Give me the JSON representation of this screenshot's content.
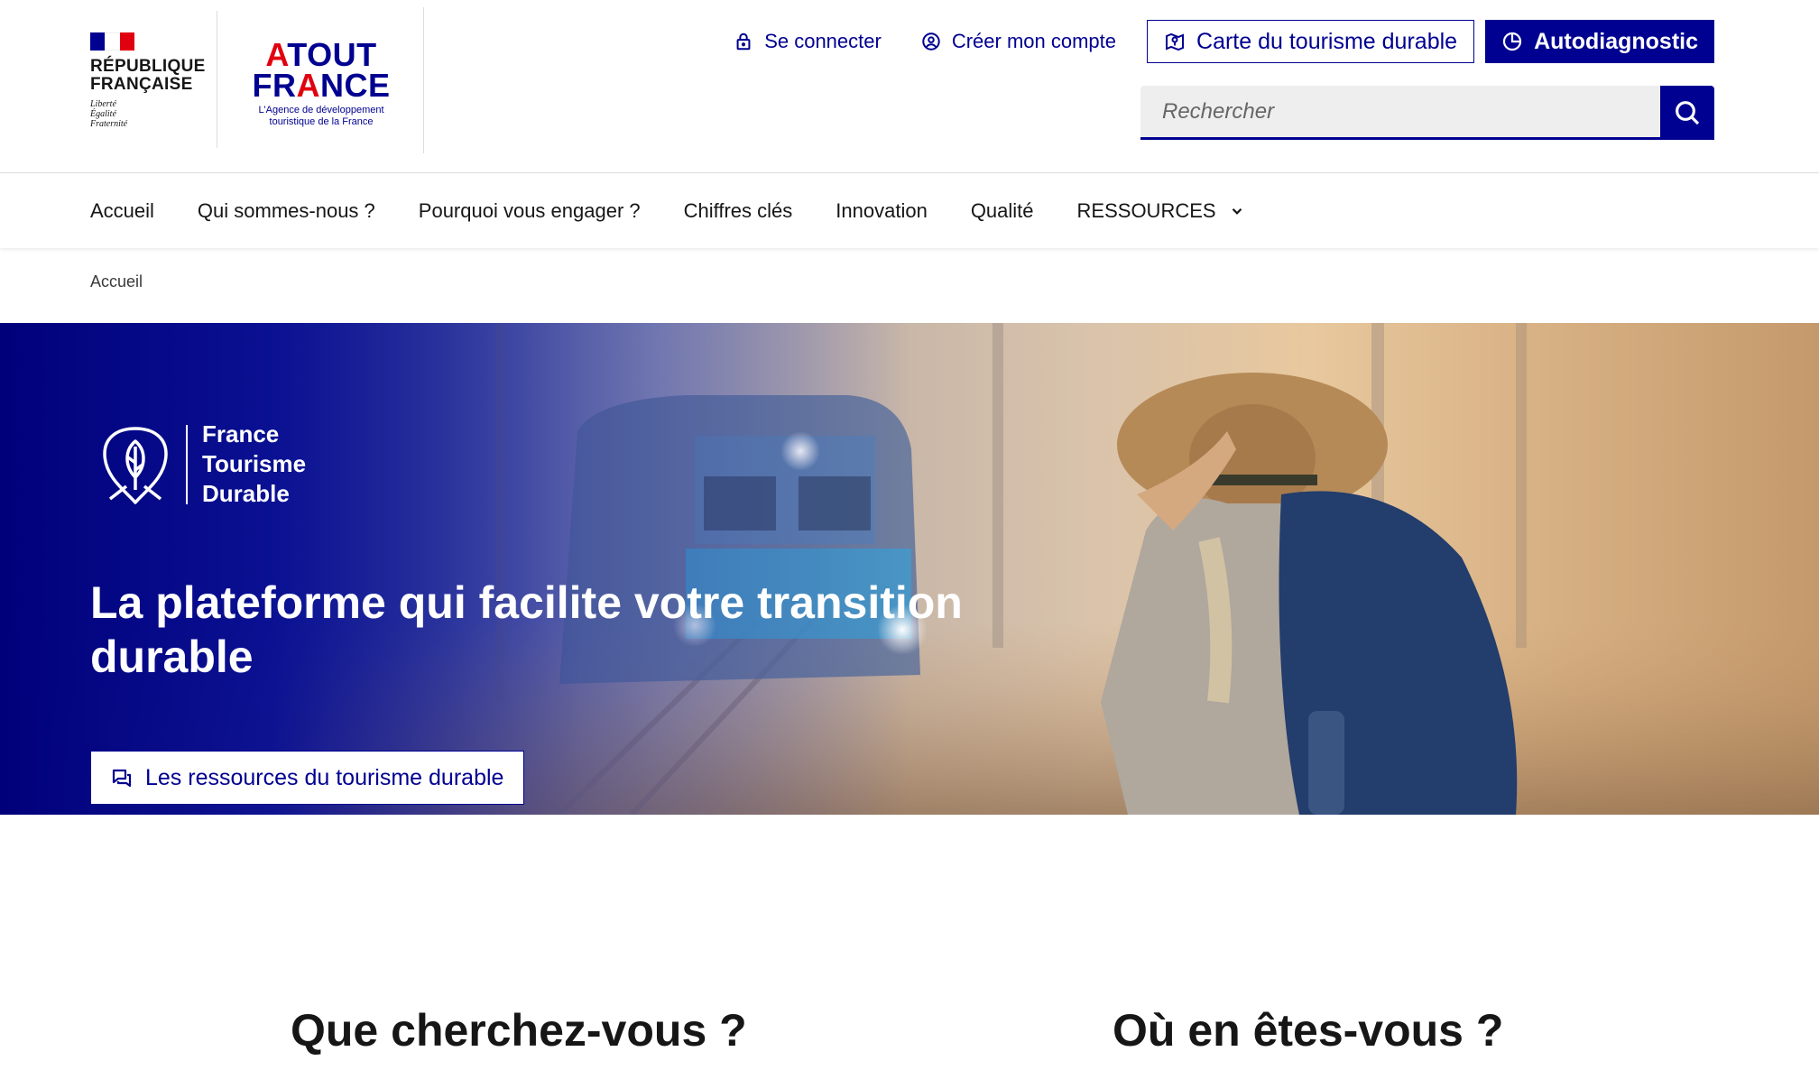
{
  "header": {
    "republic": {
      "line1": "RÉPUBLIQUE",
      "line2": "FRANÇAISE",
      "motto1": "Liberté",
      "motto2": "Égalité",
      "motto3": "Fraternité",
      "flag_colors": [
        "#000091",
        "#ffffff",
        "#e1000f"
      ]
    },
    "atout_france": {
      "line1_a": "A",
      "line1_rest": "TOUT",
      "line2_a": "FR",
      "line2_r": "A",
      "line2_rest": "NCE",
      "sub1": "L'Agence de développement",
      "sub2": "touristique de la France"
    },
    "tools": {
      "login": "Se connecter",
      "create_account": "Créer mon compte",
      "map_button": "Carte du tourisme durable",
      "autodiag_button": "Autodiagnostic"
    },
    "search": {
      "placeholder": "Rechercher"
    }
  },
  "nav": {
    "items": [
      {
        "label": "Accueil"
      },
      {
        "label": "Qui sommes-nous ?"
      },
      {
        "label": "Pourquoi vous engager ?"
      },
      {
        "label": "Chiffres clés"
      },
      {
        "label": "Innovation"
      },
      {
        "label": "Qualité"
      },
      {
        "label": "RESSOURCES"
      }
    ]
  },
  "breadcrumb": {
    "current": "Accueil"
  },
  "hero": {
    "brand": {
      "line1": "France",
      "line2": "Tourisme",
      "line3": "Durable"
    },
    "title": "La plateforme qui facilite votre transition durable",
    "cta": "Les ressources du tourisme durable"
  },
  "sections": {
    "left_heading": "Que cherchez-vous ?",
    "right_heading": "Où en êtes-vous ?"
  },
  "colors": {
    "primary": "#000091",
    "accent_red": "#e1000f"
  }
}
